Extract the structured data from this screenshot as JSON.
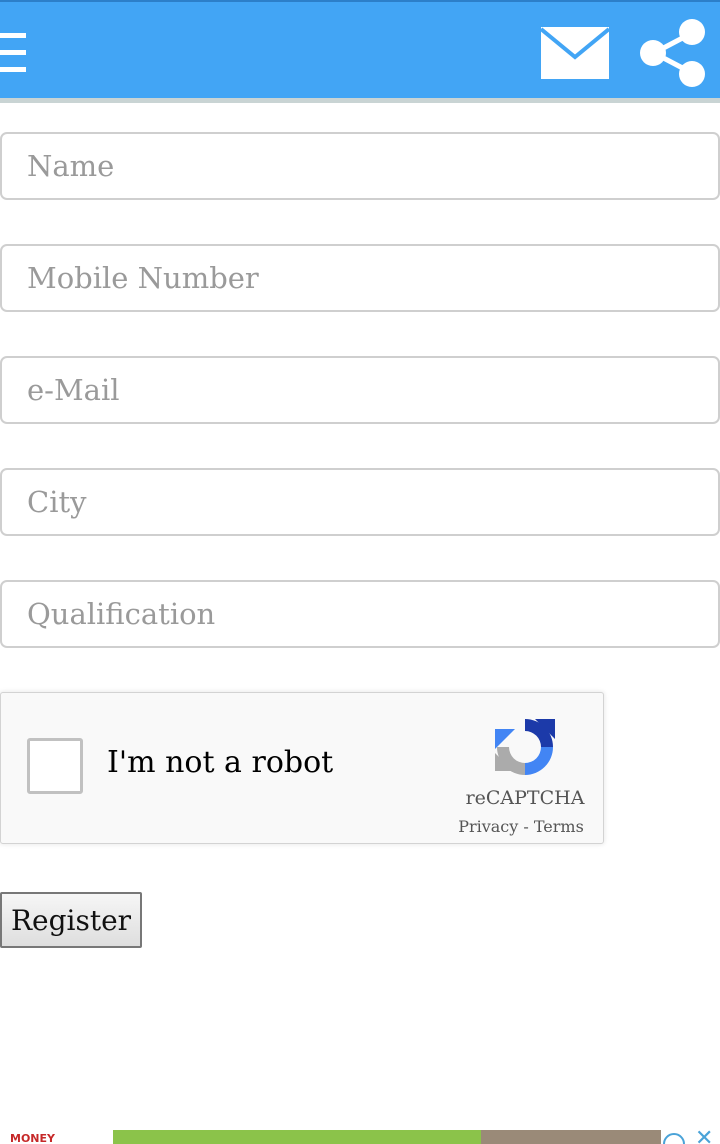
{
  "header": {
    "background_color": "#42a5f5",
    "menu_icon": "hamburger-menu-icon",
    "mail_icon": "envelope-icon",
    "share_icon": "share-icon"
  },
  "form": {
    "name_placeholder": "Name",
    "mobile_placeholder": "Mobile Number",
    "email_placeholder": "e-Mail",
    "city_placeholder": "City",
    "qualification_placeholder": "Qualification"
  },
  "captcha": {
    "label": "I'm not a robot",
    "brand": "reCAPTCHA",
    "privacy": "Privacy",
    "separator": " - ",
    "terms": "Terms"
  },
  "register_label": "Register",
  "ad": {
    "left_text": "MONEY"
  }
}
